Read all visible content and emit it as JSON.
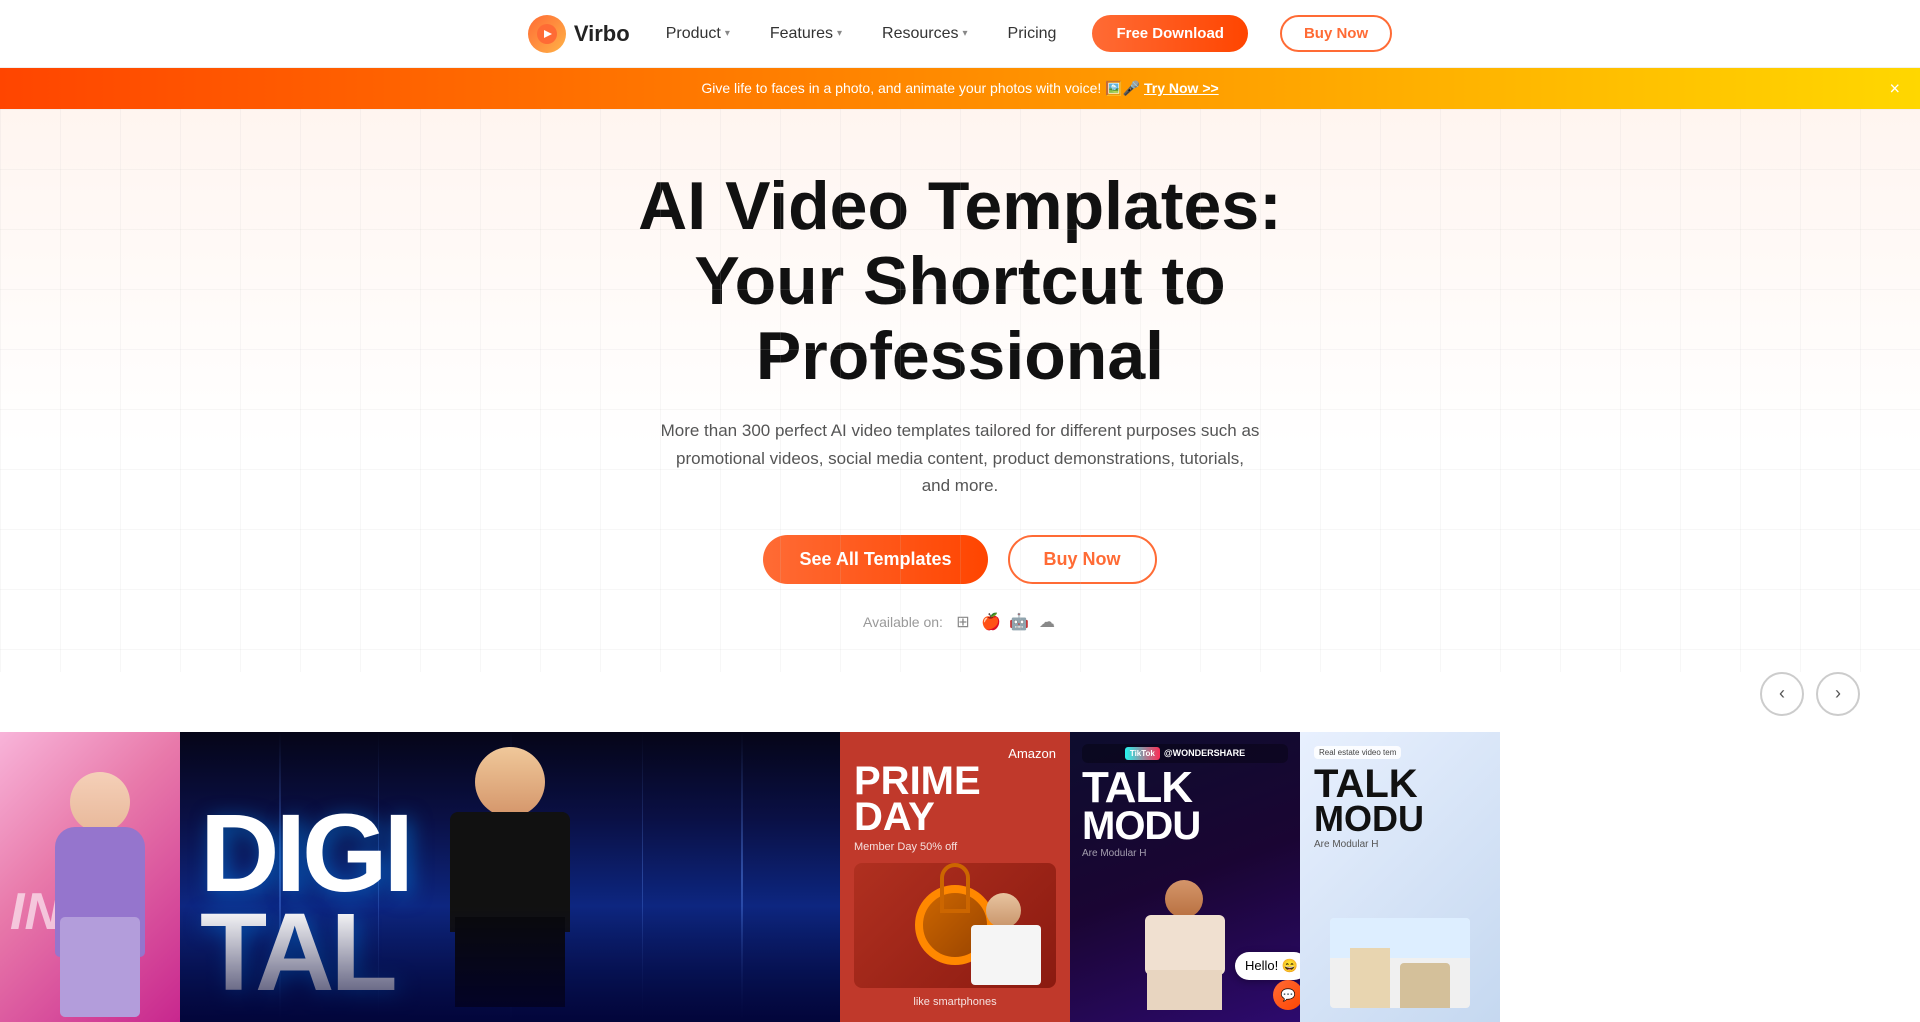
{
  "navbar": {
    "logo_text": "Virbo",
    "nav_items": [
      {
        "label": "Product",
        "has_dropdown": true
      },
      {
        "label": "Features",
        "has_dropdown": true
      },
      {
        "label": "Resources",
        "has_dropdown": true
      },
      {
        "label": "Pricing",
        "has_dropdown": false
      }
    ],
    "btn_free_download": "Free Download",
    "btn_buy_now": "Buy Now"
  },
  "banner": {
    "text": "Give life to faces in a photo, and animate your photos with voice! 🖼️🎤",
    "link_text": "Try Now >>",
    "close_label": "×"
  },
  "hero": {
    "title_line1": "AI Video Templates:",
    "title_line2": "Your Shortcut to Professional",
    "subtitle": "More than 300 perfect AI video templates tailored for different purposes such as promotional videos, social media content, product demonstrations, tutorials, and more.",
    "btn_see_templates": "See All Templates",
    "btn_buy_now": "Buy Now",
    "available_label": "Available on:"
  },
  "carousel": {
    "prev_label": "‹",
    "next_label": "›"
  },
  "video_cards": [
    {
      "id": "card-pink",
      "partial_text": "ING",
      "type": "fashion"
    },
    {
      "id": "card-digital",
      "word": "DIGITAL",
      "type": "digital-main"
    },
    {
      "id": "card-amazon",
      "brand": "Amazon",
      "event": "PRIME DAY",
      "sub": "Member Day 50% off",
      "caption": "like smartphones",
      "type": "promo"
    },
    {
      "id": "card-tiktok",
      "handle": "@WONDERSHARE",
      "title": "TALK",
      "subtitle2": "MODU",
      "desc": "Are Modular H",
      "greeting": "Hello! 😄",
      "type": "social"
    },
    {
      "id": "card-real-estate",
      "label": "Real estate video tem",
      "title": "TALK",
      "subtitle": "MODU",
      "type": "realestate"
    }
  ]
}
